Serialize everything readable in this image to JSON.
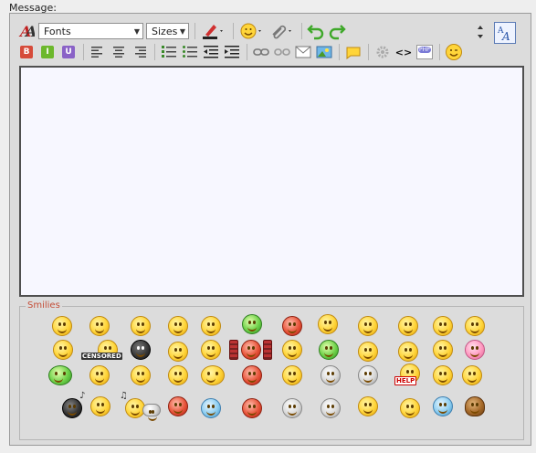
{
  "labels": {
    "message": "Message:",
    "smilies": "Smilies"
  },
  "toolbar": {
    "font_select_value": "Fonts",
    "size_select_value": "Sizes",
    "bold_label": "B",
    "italic_label": "I",
    "underline_label": "U",
    "php_label": "PHP",
    "code_label": "<>"
  },
  "smilies": {
    "censored_label": "CENSORED",
    "help_label": "HELP"
  },
  "colors": {
    "text_area_bg": "#f7f7ff",
    "smilies_legend": "#c44e38",
    "bold_bg": "#d64b3a",
    "italic_bg": "#6cb82c",
    "underline_bg": "#8a62c7"
  }
}
